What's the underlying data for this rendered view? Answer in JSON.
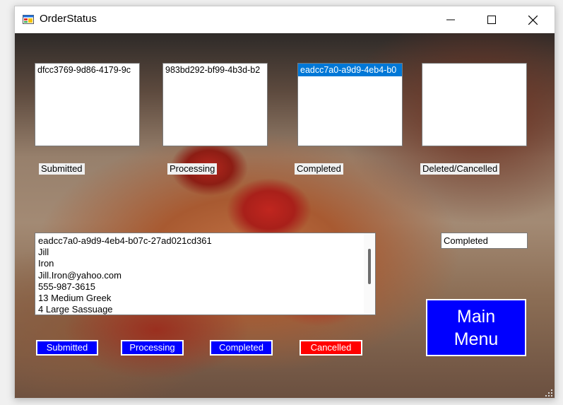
{
  "window": {
    "title": "OrderStatus",
    "icon": "app-form-icon"
  },
  "order_lists": [
    {
      "items": [
        "dfcc3769-9d86-4179-9c"
      ],
      "selected": -1,
      "label": "Submitted"
    },
    {
      "items": [
        "983bd292-bf99-4b3d-b2"
      ],
      "selected": -1,
      "label": "Processing"
    },
    {
      "items": [
        "eadcc7a0-a9d9-4eb4-b0"
      ],
      "selected": 0,
      "label": "Completed"
    },
    {
      "items": [],
      "selected": -1,
      "label": "Deleted/Cancelled"
    }
  ],
  "details": {
    "lines": [
      "eadcc7a0-a9d9-4eb4-b07c-27ad021cd361",
      "Jill",
      "Iron",
      "Jill.Iron@yahoo.com",
      "555-987-3615",
      "13 Medium Greek",
      "4 Large Sassuage"
    ]
  },
  "current_status": "Completed",
  "buttons": {
    "submitted": "Submitted",
    "processing": "Processing",
    "completed": "Completed",
    "cancelled": "Cancelled",
    "main_menu_line1": "Main",
    "main_menu_line2": "Menu"
  },
  "colors": {
    "button_blue": "#0000ff",
    "button_red": "#ff0000",
    "selection": "#0078d7"
  }
}
